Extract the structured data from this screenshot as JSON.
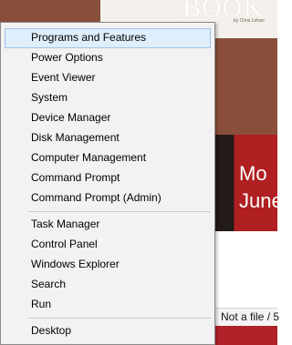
{
  "background": {
    "book_title": "BOOK",
    "book_byline": "by Chris Lohan",
    "dark_text_lines": [
      "Mo",
      "June"
    ],
    "status_text": "Not a file / 5"
  },
  "menu": {
    "groups": [
      [
        {
          "label": "Programs and Features",
          "selected": true
        },
        {
          "label": "Power Options"
        },
        {
          "label": "Event Viewer"
        },
        {
          "label": "System"
        },
        {
          "label": "Device Manager"
        },
        {
          "label": "Disk Management"
        },
        {
          "label": "Computer Management"
        },
        {
          "label": "Command Prompt"
        },
        {
          "label": "Command Prompt (Admin)"
        }
      ],
      [
        {
          "label": "Task Manager"
        },
        {
          "label": "Control Panel"
        },
        {
          "label": "Windows Explorer"
        },
        {
          "label": "Search"
        },
        {
          "label": "Run"
        }
      ],
      [
        {
          "label": "Desktop"
        }
      ]
    ]
  }
}
